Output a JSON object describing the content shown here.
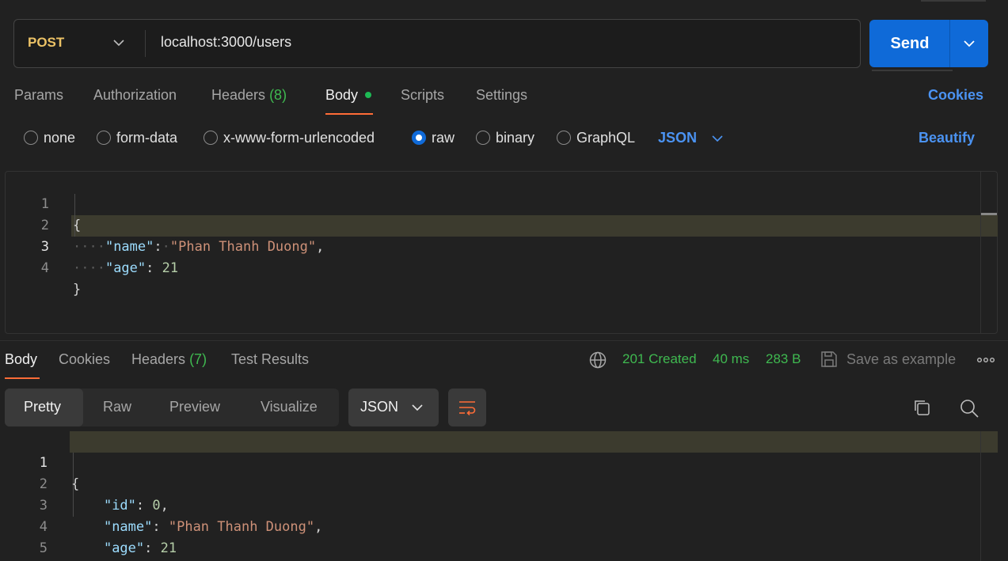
{
  "request": {
    "method": "POST",
    "url": "localhost:3000/users",
    "send_label": "Send"
  },
  "request_tabs": {
    "params": "Params",
    "authorization": "Authorization",
    "headers": "Headers",
    "headers_count": "(8)",
    "body": "Body",
    "scripts": "Scripts",
    "settings": "Settings",
    "cookies": "Cookies"
  },
  "body_modes": {
    "none": "none",
    "form_data": "form-data",
    "urlencoded": "x-www-form-urlencoded",
    "raw": "raw",
    "binary": "binary",
    "graphql": "GraphQL",
    "selected": "raw",
    "language": "JSON",
    "beautify": "Beautify"
  },
  "request_body": {
    "line_numbers": [
      "1",
      "2",
      "3",
      "4"
    ],
    "open_brace": "{",
    "close_brace": "}",
    "name_key": "\"name\"",
    "name_value": "\"Phan Thanh Duong\"",
    "age_key": "\"age\"",
    "age_value": "21"
  },
  "response_tabs": {
    "body": "Body",
    "cookies": "Cookies",
    "headers": "Headers",
    "headers_count": "(7)",
    "test_results": "Test Results"
  },
  "response_status": {
    "code": "201 Created",
    "time": "40 ms",
    "size": "283 B",
    "save_example": "Save as example"
  },
  "response_view": {
    "pretty": "Pretty",
    "raw": "Raw",
    "preview": "Preview",
    "visualize": "Visualize",
    "language": "JSON"
  },
  "response_body": {
    "line_numbers": [
      "1",
      "2",
      "3",
      "4",
      "5"
    ],
    "open_brace": "{",
    "close_brace": "}",
    "id_key": "\"id\"",
    "id_value": "0",
    "name_key": "\"name\"",
    "name_value": "\"Phan Thanh Duong\"",
    "age_key": "\"age\"",
    "age_value": "21"
  },
  "icons": {
    "method_dropdown": "chevron-down-icon",
    "send_dropdown": "chevron-down-icon",
    "globe": "globe-icon",
    "save": "save-icon",
    "more": "more-horizontal-icon",
    "wrap": "wrap-lines-icon",
    "copy": "copy-icon",
    "search": "search-icon"
  },
  "colors": {
    "accent": "#0f6ad8",
    "method": "#ecc266",
    "success": "#3fb950",
    "tab_indicator": "#ff6c37",
    "link": "#4b93f2"
  }
}
